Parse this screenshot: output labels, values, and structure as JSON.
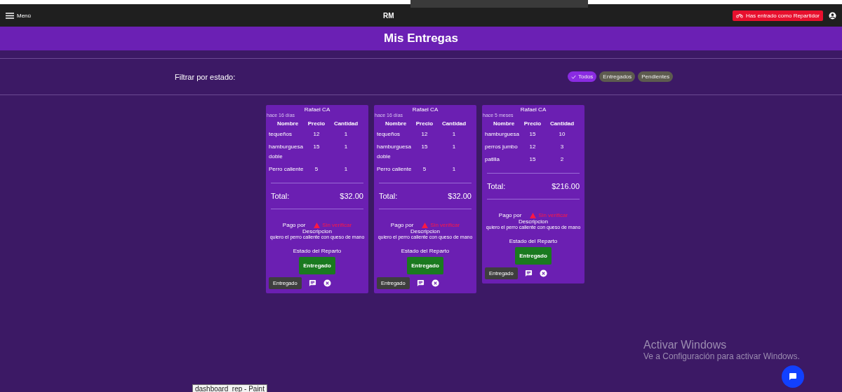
{
  "app_bar": {
    "menu_label": "Menú",
    "title": "RM",
    "role_badge": "Has entrado como Repartidor"
  },
  "page_title": "Mis Entregas",
  "filter": {
    "label": "Filtrar por estado:",
    "chips": [
      {
        "label": "Todos",
        "selected": true
      },
      {
        "label": "Entregados",
        "selected": false
      },
      {
        "label": "Pendientes",
        "selected": false
      }
    ]
  },
  "orders": [
    {
      "customer": "Rafael CA",
      "time": "hace 16 días",
      "columns": [
        "Nombre",
        "Precio",
        "Cantidad"
      ],
      "items": [
        [
          "tequeños",
          "12",
          "1"
        ],
        [
          "hamburguesa doble",
          "15",
          "1"
        ],
        [
          "Perro caliente",
          "5",
          "1"
        ]
      ],
      "total_label": "Total:",
      "total": "$32.00",
      "payment_label": "Pago por",
      "payment_status": "Sin verificar",
      "description_label": "Descripcion",
      "description": "quiero el perro caliente con queso de mano",
      "status_label": "Estado del Reparto",
      "status_button": "Entregado",
      "status_chip": "Entregado"
    },
    {
      "customer": "Rafael CA",
      "time": "hace 16 días",
      "columns": [
        "Nombre",
        "Precio",
        "Cantidad"
      ],
      "items": [
        [
          "tequeños",
          "12",
          "1"
        ],
        [
          "hamburguesa doble",
          "15",
          "1"
        ],
        [
          "Perro caliente",
          "5",
          "1"
        ]
      ],
      "total_label": "Total:",
      "total": "$32.00",
      "payment_label": "Pago por",
      "payment_status": "Sin verificar",
      "description_label": "Descripcion",
      "description": "quiero el perro caliente con queso de mano",
      "status_label": "Estado del Reparto",
      "status_button": "Entregado",
      "status_chip": "Entregado"
    },
    {
      "customer": "Rafael CA",
      "time": "hace 5 meses",
      "columns": [
        "Nombre",
        "Precio",
        "Cantidad"
      ],
      "items": [
        [
          "hamburguesa",
          "15",
          "10"
        ],
        [
          "perros jumbo",
          "12",
          "3"
        ],
        [
          "patilla",
          "15",
          "2"
        ]
      ],
      "total_label": "Total:",
      "total": "$216.00",
      "payment_label": "Pago por",
      "payment_status": "Sin verificar",
      "description_label": "Descripcion",
      "description": "quiero el perro caliente con queso de mano",
      "status_label": "Estado del Reparto",
      "status_button": "Entregado",
      "status_chip": "Entregado"
    }
  ],
  "activation_notice": {
    "title": "Activar Windows",
    "text": "Ve a Configuración para activar Windows."
  },
  "taskbar_tooltip": "dashboard_rep - Paint"
}
